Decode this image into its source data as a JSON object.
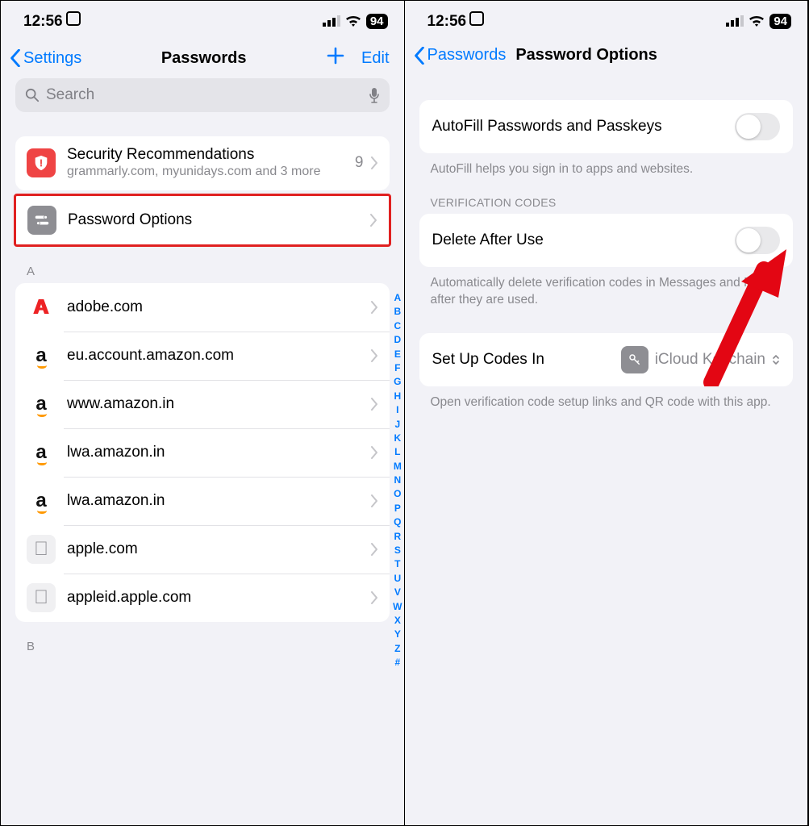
{
  "status": {
    "time": "12:56",
    "battery": "94"
  },
  "left": {
    "nav": {
      "back": "Settings",
      "title": "Passwords",
      "edit": "Edit"
    },
    "search": {
      "placeholder": "Search"
    },
    "security": {
      "title": "Security Recommendations",
      "subtitle": "grammarly.com, myunidays.com and 3 more",
      "count": "9"
    },
    "password_options": "Password Options",
    "section_a": "A",
    "section_b": "B",
    "sites": [
      {
        "label": "adobe.com",
        "brand": "adobe"
      },
      {
        "label": "eu.account.amazon.com",
        "brand": "amazon"
      },
      {
        "label": "www.amazon.in",
        "brand": "amazon"
      },
      {
        "label": "lwa.amazon.in",
        "brand": "amazon"
      },
      {
        "label": "lwa.amazon.in",
        "brand": "amazon"
      },
      {
        "label": "apple.com",
        "brand": "apple"
      },
      {
        "label": "appleid.apple.com",
        "brand": "apple"
      }
    ],
    "index": [
      "A",
      "B",
      "C",
      "D",
      "E",
      "F",
      "G",
      "H",
      "I",
      "J",
      "K",
      "L",
      "M",
      "N",
      "O",
      "P",
      "Q",
      "R",
      "S",
      "T",
      "U",
      "V",
      "W",
      "X",
      "Y",
      "Z",
      "#"
    ]
  },
  "right": {
    "nav": {
      "back": "Passwords",
      "title": "Password Options"
    },
    "autofill": {
      "label": "AutoFill Passwords and Passkeys",
      "footer": "AutoFill helps you sign in to apps and websites."
    },
    "verification": {
      "header": "VERIFICATION CODES",
      "delete_label": "Delete After Use",
      "footer": "Automatically delete verification codes in Messages and Mail after they are used."
    },
    "setup": {
      "label": "Set Up Codes In",
      "value": "iCloud Keychain",
      "footer": "Open verification code setup links and QR code with this app."
    }
  }
}
